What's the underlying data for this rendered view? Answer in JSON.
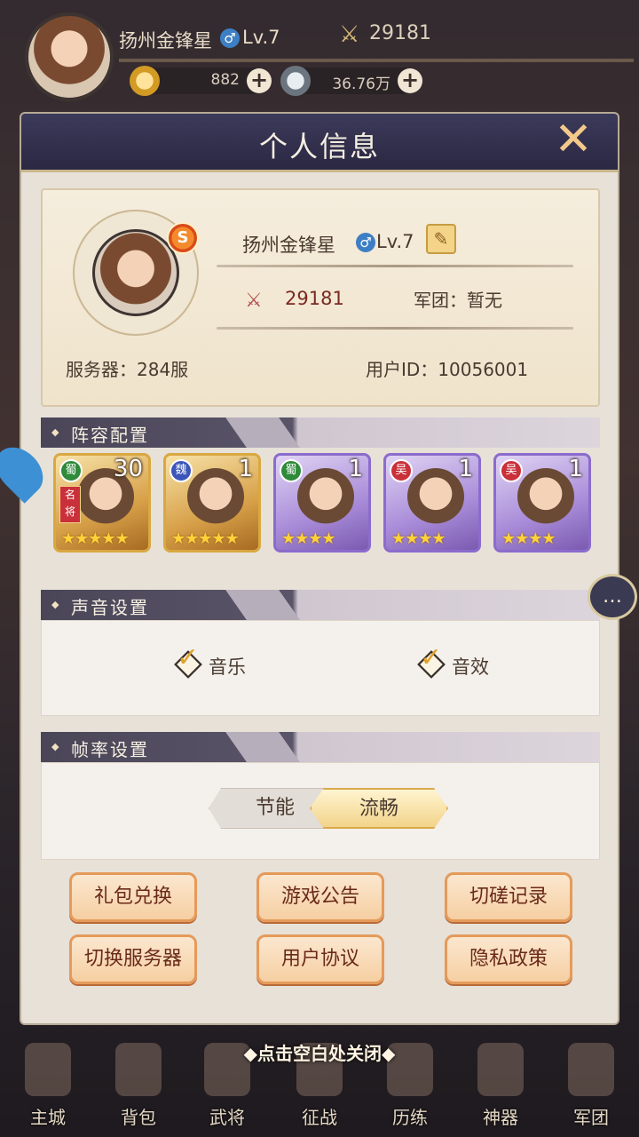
{
  "hud": {
    "name": "扬州金锋星",
    "gender": "♂",
    "level": "Lv.7",
    "power": "29181",
    "gold": "882",
    "silver": "36.76万",
    "plus": "+"
  },
  "panel": {
    "title": "个人信息",
    "close": "✕"
  },
  "profile": {
    "name": "扬州金锋星",
    "gender": "♂",
    "level": "Lv.7",
    "power": "29181",
    "guild": "军团：暂无",
    "server": "服务器：284服",
    "user_id": "用户ID：10056001",
    "badge": "S"
  },
  "lineup": {
    "title": "阵容配置",
    "heroes": [
      {
        "faction": "蜀",
        "count": "30",
        "stars": "★★★★★",
        "tag": "名将",
        "rarity": "gold"
      },
      {
        "faction": "魏",
        "count": "1",
        "stars": "★★★★★",
        "rarity": "gold"
      },
      {
        "faction": "蜀",
        "count": "1",
        "stars": "★★★★",
        "rarity": "purple"
      },
      {
        "faction": "吴",
        "count": "1",
        "stars": "★★★★",
        "rarity": "purple"
      },
      {
        "faction": "吴",
        "count": "1",
        "stars": "★★★★",
        "rarity": "purple"
      }
    ]
  },
  "sound": {
    "title": "声音设置",
    "music": "音乐",
    "effects": "音效",
    "music_checked": true,
    "effects_checked": true
  },
  "framerate": {
    "title": "帧率设置",
    "option_off": "节能",
    "option_on": "流畅",
    "selected": "流畅"
  },
  "buttons": {
    "gift": "礼包兑换",
    "notice": "游戏公告",
    "duel_log": "切磋记录",
    "switch_server": "切换服务器",
    "agreement": "用户协议",
    "privacy": "隐私政策"
  },
  "close_hint": "◆点击空白处关闭◆",
  "nav": {
    "items": [
      "主城",
      "背包",
      "武将",
      "征战",
      "历练",
      "神器",
      "军团"
    ]
  },
  "colors": {
    "accent": "#e59a5a",
    "panel_header": "#2a2842",
    "power_red": "#7a2a22"
  }
}
